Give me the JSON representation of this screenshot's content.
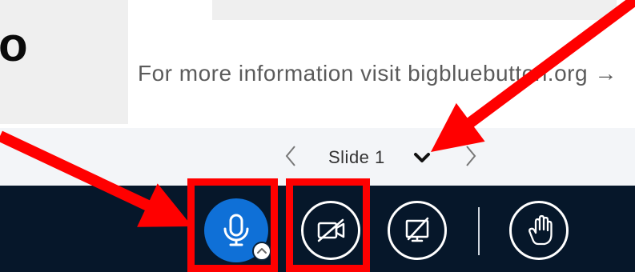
{
  "slide": {
    "big_text": "o",
    "info_text": "For more information visit bigbluebutton.org →"
  },
  "slide_nav": {
    "prev_icon": "chevron-left-icon",
    "current_slide": "Slide 1",
    "dropdown_icon": "chevron-down-icon",
    "next_icon": "chevron-right-icon"
  },
  "toolbar": {
    "audio": {
      "icon": "microphone-icon",
      "active": true,
      "options_icon": "chevron-up-icon"
    },
    "video": {
      "icon": "video-off-icon",
      "active": false
    },
    "screenshare": {
      "icon": "screen-share-off-icon",
      "active": false
    },
    "raise_hand": {
      "icon": "hand-icon"
    }
  },
  "annotations": {
    "color": "#ff0000"
  },
  "colors": {
    "toolbar_bg": "#06172a",
    "audio_active": "#0f70d7",
    "nav_bg": "#f3f5f8",
    "slide_block": "#efefef",
    "info_text": "#5b5b5b"
  }
}
